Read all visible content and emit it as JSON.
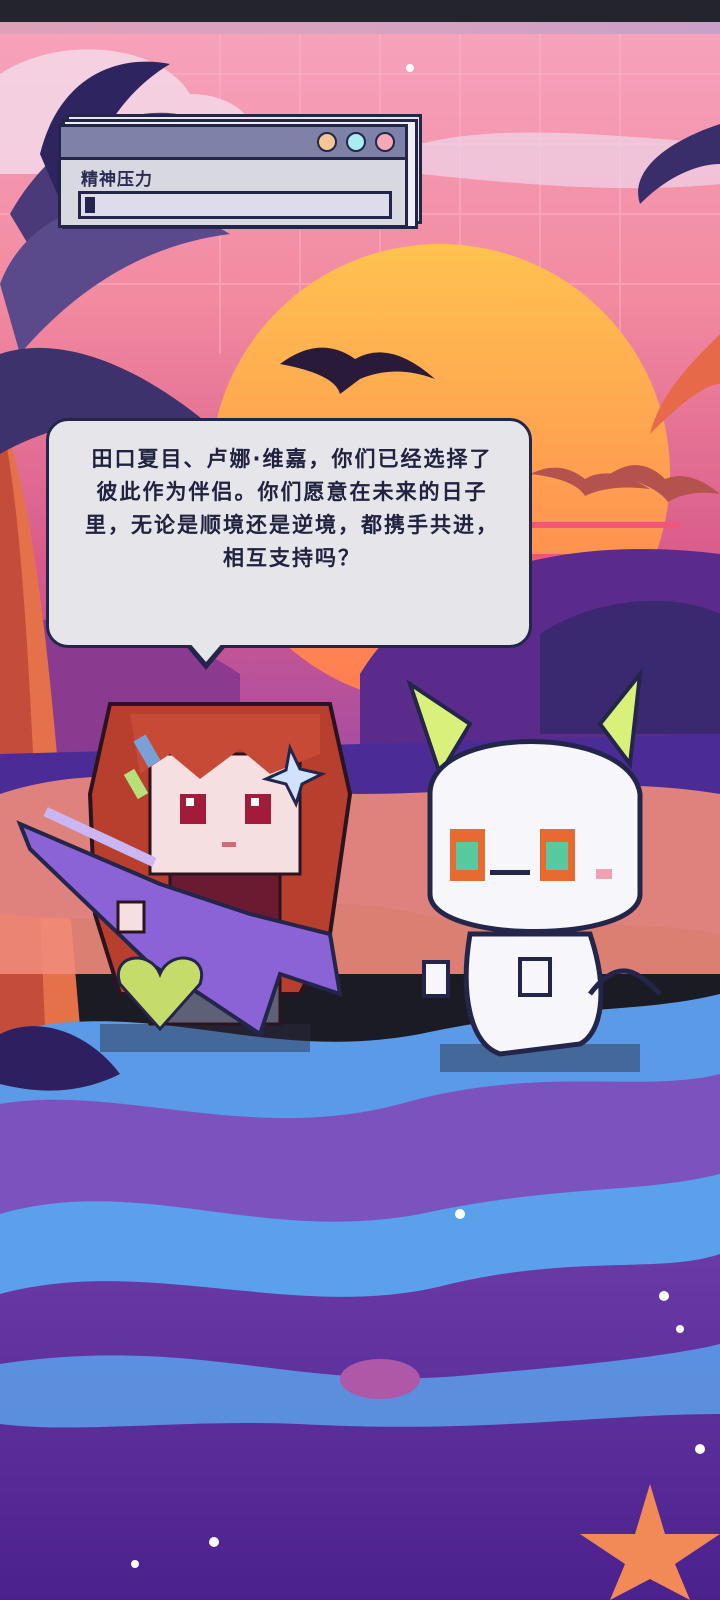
{
  "hud": {
    "window_label": "精神压力",
    "stress_level_fraction": 0.03,
    "window_buttons": [
      "#f4c595",
      "#a9ecf2",
      "#f6a8b7"
    ]
  },
  "dialogue": {
    "text": "田口夏目、卢娜·维嘉，你们已经选择了彼此作为伴侣。你们愿意在未来的日子里，无论是顺境还是逆境，都携手共进，相互支持吗？"
  },
  "characters": [
    {
      "name": "guitar-girl",
      "hair": "#b83e2d",
      "guitar": "#8b63d6"
    },
    {
      "name": "white-ghost-cat",
      "horns": "#d9f07a",
      "body": "#f6f6fb"
    }
  ],
  "colors": {
    "sky_top": "#f7a4b9",
    "sun": "#ffb54a",
    "sea": "#5b9ee8",
    "ground": "#5b2e9c",
    "accent": "#23264a"
  }
}
